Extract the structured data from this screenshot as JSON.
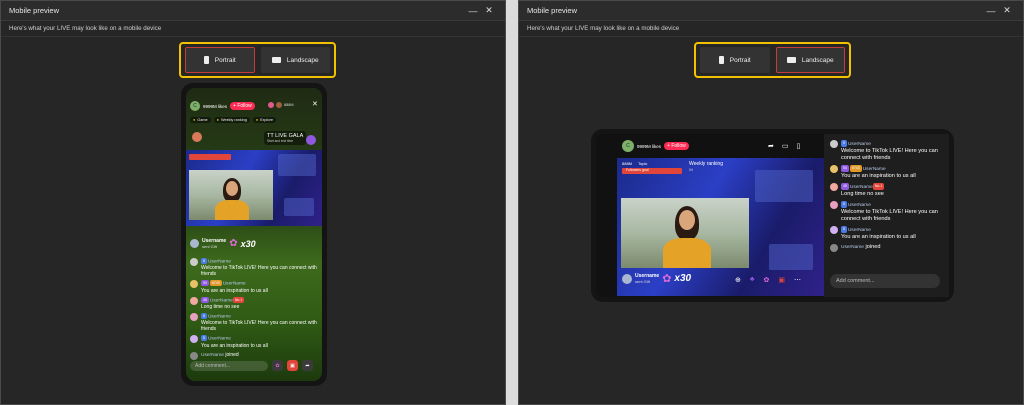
{
  "window": {
    "title": "Mobile preview",
    "minimize": "—",
    "close": "✕",
    "subtitle": "Here's what your LIVE may look like on a mobile device"
  },
  "toggle": {
    "portrait": "Portrait",
    "landscape": "Landscape"
  },
  "live": {
    "likes": "9999M likes",
    "follow": "+ Follow",
    "viewers": "888M",
    "pill_game": "Game",
    "pill_weekly": "Weekly ranking",
    "pill_explore": "Explore",
    "gala_title": "TT LIVE GALA",
    "gala_sub": "Start and end time",
    "topic": "Topic",
    "followers_goal": "Followers goal",
    "weekly_ranking": "Weekly ranking",
    "ranking_value": "5/t",
    "gift_user": "Username",
    "gift_action": "sent Gift",
    "gift_count": "x30"
  },
  "chat": {
    "messages": [
      {
        "badges": [
          "5"
        ],
        "name": "UserName",
        "text": "Welcome to TikTok LIVE! Here you can connect with friends"
      },
      {
        "badges": [
          "50",
          "#743"
        ],
        "name": "UserName",
        "text": "You are an inspiration to us all"
      },
      {
        "badges": [
          "45",
          "No.1"
        ],
        "name": "UserName",
        "text": "Long time no see"
      },
      {
        "badges": [
          "5"
        ],
        "name": "UserName",
        "text": "Welcome to TikTok LIVE! Here you can connect with friends"
      },
      {
        "badges": [
          "5"
        ],
        "name": "UserName",
        "text": "You are an inspiration to us all"
      }
    ],
    "joined_name": "UserName",
    "joined_text": "joined",
    "add_comment_placeholder": "Add comment..."
  },
  "colors": {
    "accent": "#f2c200",
    "follow": "#fe2c55",
    "active_border": "#c43c3c"
  }
}
